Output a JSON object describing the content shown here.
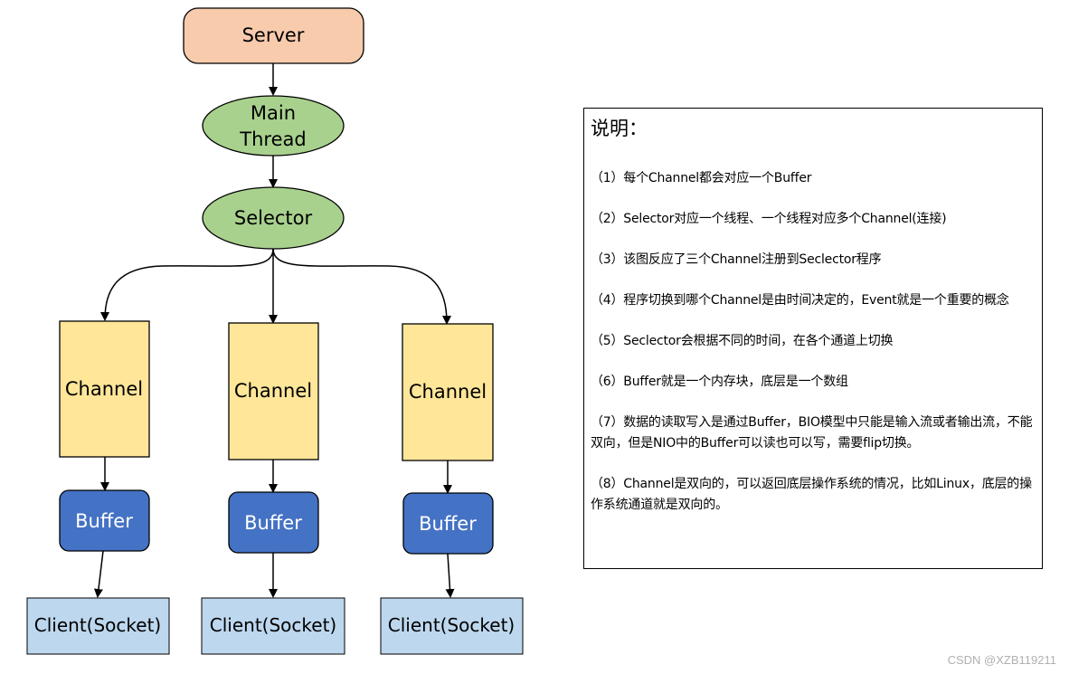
{
  "diagram": {
    "server": {
      "label": "Server",
      "color": "#f8cbad"
    },
    "main_thread": {
      "line1": "Main",
      "line2": "Thread",
      "color": "#a9d18e"
    },
    "selector": {
      "label": "Selector",
      "color": "#a9d18e"
    },
    "columns": [
      {
        "channel": "Channel",
        "buffer": "Buffer",
        "client": "Client(Socket)"
      },
      {
        "channel": "Channel",
        "buffer": "Buffer",
        "client": "Client(Socket)"
      },
      {
        "channel": "Channel",
        "buffer": "Buffer",
        "client": "Client(Socket)"
      }
    ],
    "colors": {
      "channel": "#ffe699",
      "buffer": "#4472c4",
      "client": "#bdd7ee",
      "stroke": "#000000"
    }
  },
  "notes": {
    "title": "说明：",
    "items": [
      "（1）每个Channel都会对应一个Buffer",
      "（2）Selector对应一个线程、一个线程对应多个Channel(连接)",
      "（3）该图反应了三个Channel注册到Seclector程序",
      "（4）程序切换到哪个Channel是由时间决定的，Event就是一个重要的概念",
      "（5）Seclector会根据不同的时间，在各个通道上切换",
      "（6）Buffer就是一个内存块，底层是一个数组",
      "（7）数据的读取写入是通过Buffer，BIO模型中只能是输入流或者输出流，不能双向，但是NIO中的Buffer可以读也可以写，需要flip切换。",
      "（8）Channel是双向的，可以返回底层操作系统的情况，比如Linux，底层的操作系统通道就是双向的。"
    ]
  },
  "watermark": "CSDN @XZB119211"
}
